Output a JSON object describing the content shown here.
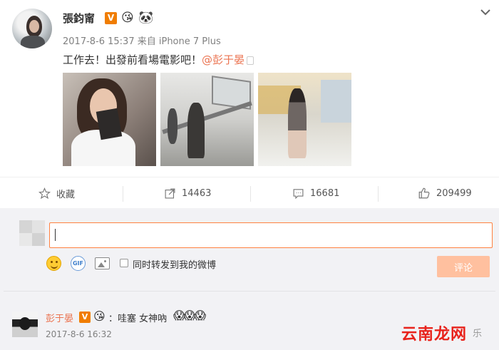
{
  "post": {
    "author": "張鈞甯",
    "verified_badge": "V",
    "emoji_1": "😘",
    "emoji_2": "🐼",
    "meta": "2017-8-6 15:37 来自 iPhone 7 Plus",
    "text_main": "工作去！出發前看場電影吧！",
    "mention": "@彭于晏",
    "photo_count": 3
  },
  "actions": {
    "favorite_label": "收藏",
    "repost_count": "14463",
    "comment_count": "16681",
    "like_count": "209499"
  },
  "comment_box": {
    "value": "",
    "repost_checkbox_label": "同时转发到我的微博",
    "submit_label": "评论"
  },
  "comment": {
    "author": "彭于晏",
    "verified_badge": "V",
    "emoji": "😘",
    "text": "：哇塞 女神吶",
    "emojis": "😱😱😱",
    "time": "2017-8-6 16:32"
  },
  "watermark": {
    "main": "云南龙网",
    "tail": "乐"
  },
  "colors": {
    "accent": "#eb7350",
    "input_border": "#ff8140",
    "submit_bg": "#ffc09f",
    "verified": "#f07d00",
    "watermark": "#e8231c"
  }
}
